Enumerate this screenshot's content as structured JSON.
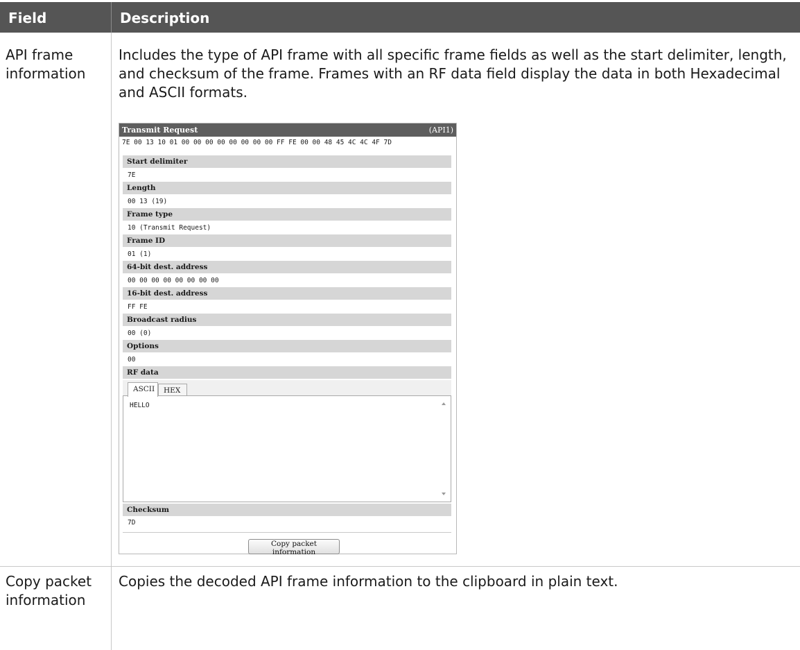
{
  "table": {
    "header": {
      "field": "Field",
      "description": "Description"
    },
    "rows": [
      {
        "field": "API frame information",
        "description": "Includes the type of API frame with all specific frame fields as well as the start delimiter, length, and checksum of the frame. Frames with an RF data field display the data in both Hexadecimal and ASCII formats."
      },
      {
        "field": "Copy packet information",
        "description": "Copies the decoded API frame information to the clipboard in plain text."
      }
    ]
  },
  "panel": {
    "title": "Transmit Request",
    "api_mode": "(API1)",
    "hex": "7E 00 13 10 01 00 00 00 00 00 00 00 00 FF FE 00 00 48 45 4C 4C 4F 7D",
    "fields": [
      {
        "label": "Start delimiter",
        "value": "7E"
      },
      {
        "label": "Length",
        "value": "00 13 (19)"
      },
      {
        "label": "Frame type",
        "value": "10 (Transmit Request)"
      },
      {
        "label": "Frame ID",
        "value": "01 (1)"
      },
      {
        "label": "64-bit dest. address",
        "value": "00 00 00 00 00 00 00 00"
      },
      {
        "label": "16-bit dest. address",
        "value": "FF FE"
      },
      {
        "label": "Broadcast radius",
        "value": "00 (0)"
      },
      {
        "label": "Options",
        "value": "00"
      }
    ],
    "rf_data": {
      "label": "RF data",
      "tabs": [
        "ASCII",
        "HEX"
      ],
      "active_tab": "ASCII",
      "value": "HELLO"
    },
    "checksum": {
      "label": "Checksum",
      "value": "7D"
    },
    "copy_button": "Copy packet information"
  }
}
